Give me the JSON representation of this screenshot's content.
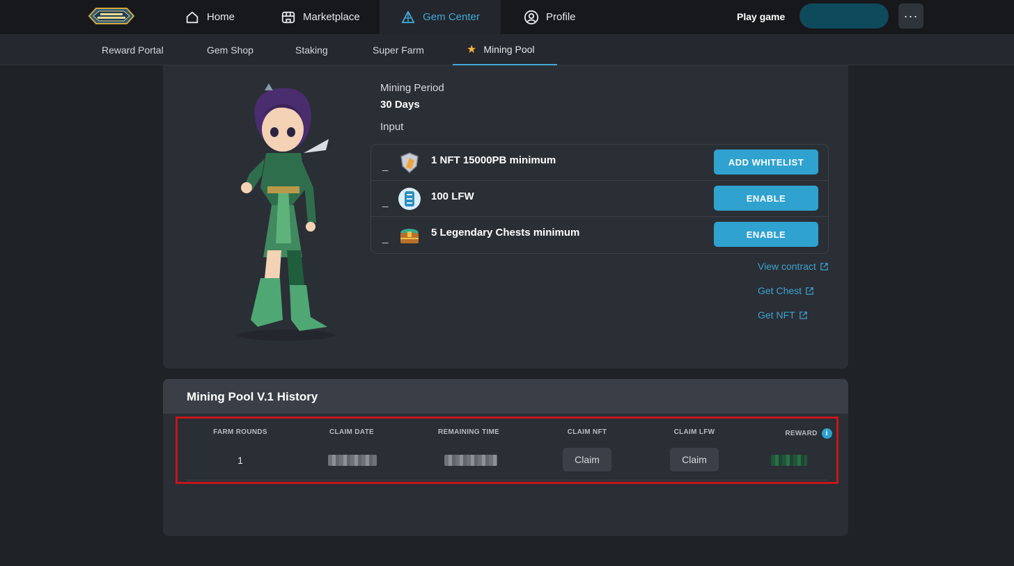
{
  "header": {
    "logo_text": "LEGEND FANTASY WAR",
    "nav": [
      {
        "label": "Home",
        "icon": "home-icon"
      },
      {
        "label": "Marketplace",
        "icon": "storefront-icon"
      },
      {
        "label": "Gem Center",
        "icon": "gem-icon"
      },
      {
        "label": "Profile",
        "icon": "user-icon"
      }
    ],
    "play_game": "Play game",
    "more": "···"
  },
  "subnav": [
    {
      "label": "Reward Portal"
    },
    {
      "label": "Gem Shop"
    },
    {
      "label": "Staking"
    },
    {
      "label": "Super Farm"
    },
    {
      "label": "Mining Pool",
      "icon": "star-icon"
    }
  ],
  "pool": {
    "period_label": "Mining Period",
    "period_value": "30 Days",
    "input_label": "Input",
    "requirements": [
      {
        "dash": "_",
        "text": "1 NFT 15000PB minimum",
        "button": "ADD WHITELIST",
        "icon": "nft-shield-icon"
      },
      {
        "dash": "_",
        "text": "100 LFW",
        "button": "ENABLE",
        "icon": "lfw-token-icon"
      },
      {
        "dash": "_",
        "text": "5 Legendary Chests minimum",
        "button": "ENABLE",
        "icon": "chest-icon"
      }
    ],
    "links": [
      {
        "label": "View contract"
      },
      {
        "label": "Get Chest"
      },
      {
        "label": "Get NFT"
      }
    ]
  },
  "history": {
    "title": "Mining Pool V.1 History",
    "columns": [
      "FARM ROUNDS",
      "CLAIM DATE",
      "REMAINING TIME",
      "CLAIM NFT",
      "CLAIM LFW",
      "REWARD"
    ],
    "rows": [
      {
        "round": "1",
        "claim_nft": "Claim",
        "claim_lfw": "Claim"
      }
    ],
    "info": "i"
  },
  "colors": {
    "accent": "#41a9d8",
    "button": "#2fa2cf",
    "highlight_border": "#c4161c",
    "star": "#f4b43a"
  }
}
